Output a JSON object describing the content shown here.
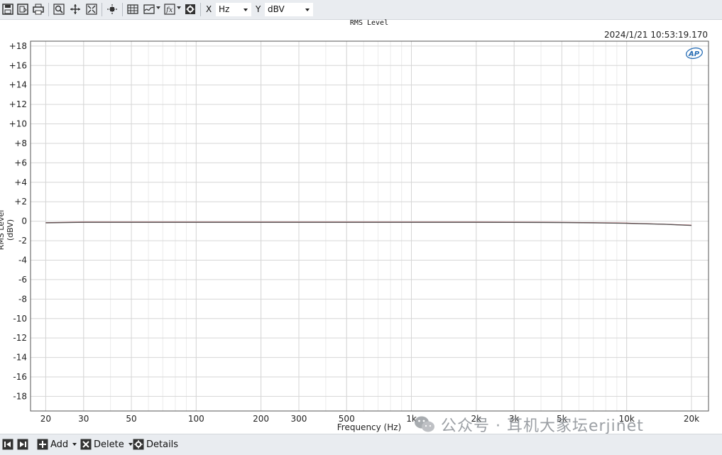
{
  "toolbar": {
    "x_label": "X",
    "x_unit": "Hz",
    "y_label": "Y",
    "y_unit": "dBV"
  },
  "header": {
    "timestamp": "2024/1/21 10:53:19.170",
    "logo_text": "AP"
  },
  "bottombar": {
    "add_label": "Add",
    "delete_label": "Delete",
    "details_label": "Details"
  },
  "watermark": {
    "text": "公众号 · 耳机大家坛erjinet"
  },
  "chart_data": {
    "type": "line",
    "title": "RMS Level",
    "xlabel": "Frequency (Hz)",
    "ylabel": "RMS Level (dBV)",
    "x_scale": "log",
    "xlim": [
      17,
      24000
    ],
    "ylim": [
      -19.5,
      18.5
    ],
    "grid": true,
    "x_ticks": [
      20,
      30,
      50,
      100,
      200,
      300,
      500,
      1000,
      2000,
      3000,
      5000,
      10000,
      20000
    ],
    "x_tick_labels": [
      "20",
      "30",
      "50",
      "100",
      "200",
      "300",
      "500",
      "1k",
      "2k",
      "3k",
      "5k",
      "10k",
      "20k"
    ],
    "y_ticks": [
      18,
      16,
      14,
      12,
      10,
      8,
      6,
      4,
      2,
      0,
      -2,
      -4,
      -6,
      -8,
      -10,
      -12,
      -14,
      -16,
      -18
    ],
    "y_tick_labels": [
      "+18",
      "+16",
      "+14",
      "+12",
      "+10",
      "+8",
      "+6",
      "+4",
      "+2",
      "0",
      "-2",
      "-4",
      "-6",
      "-8",
      "-10",
      "-12",
      "-14",
      "-16",
      "-18"
    ],
    "series": [
      {
        "color": "#8b2c35",
        "x": [
          20,
          30,
          50,
          100,
          200,
          500,
          1000,
          2000,
          5000,
          7000,
          10000,
          15000,
          20000
        ],
        "values": [
          -0.15,
          -0.1,
          -0.1,
          -0.1,
          -0.1,
          -0.1,
          -0.1,
          -0.1,
          -0.12,
          -0.15,
          -0.2,
          -0.3,
          -0.42
        ]
      },
      {
        "color": "#555555",
        "x": [
          20,
          30,
          50,
          100,
          200,
          500,
          1000,
          2000,
          5000,
          7000,
          10000,
          15000,
          20000
        ],
        "values": [
          -0.17,
          -0.12,
          -0.12,
          -0.12,
          -0.12,
          -0.12,
          -0.12,
          -0.12,
          -0.14,
          -0.17,
          -0.22,
          -0.32,
          -0.44
        ]
      }
    ]
  }
}
